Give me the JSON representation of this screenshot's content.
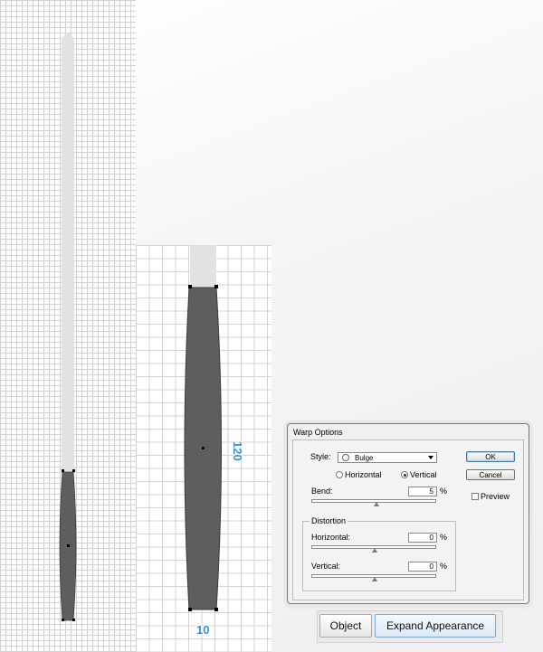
{
  "canvas": {
    "measure_height": "120",
    "measure_width": "10"
  },
  "colors": {
    "handle_light": "#e2e2e2",
    "shape_dark": "#5e5e5e",
    "measure_blue": "#3d8fd6"
  },
  "warp_dialog": {
    "title": "Warp Options",
    "style_label": "Style:",
    "style_value": "Bulge",
    "style_icon": "bulge-icon",
    "orientation_horizontal": "Horizontal",
    "orientation_vertical": "Vertical",
    "orientation_selected": "Vertical",
    "bend_label": "Bend:",
    "bend_value": "5",
    "bend_unit": "%",
    "bend_fraction": 0.525,
    "distortion_label": "Distortion",
    "horizontal_label": "Horizontal:",
    "horizontal_value": "0",
    "horizontal_unit": "%",
    "vertical_label": "Vertical:",
    "vertical_value": "0",
    "vertical_unit": "%",
    "ok_label": "OK",
    "cancel_label": "Cancel",
    "preview_label": "Preview",
    "preview_checked": false
  },
  "bottom_bar": {
    "object_label": "Object",
    "expand_label": "Expand Appearance"
  }
}
